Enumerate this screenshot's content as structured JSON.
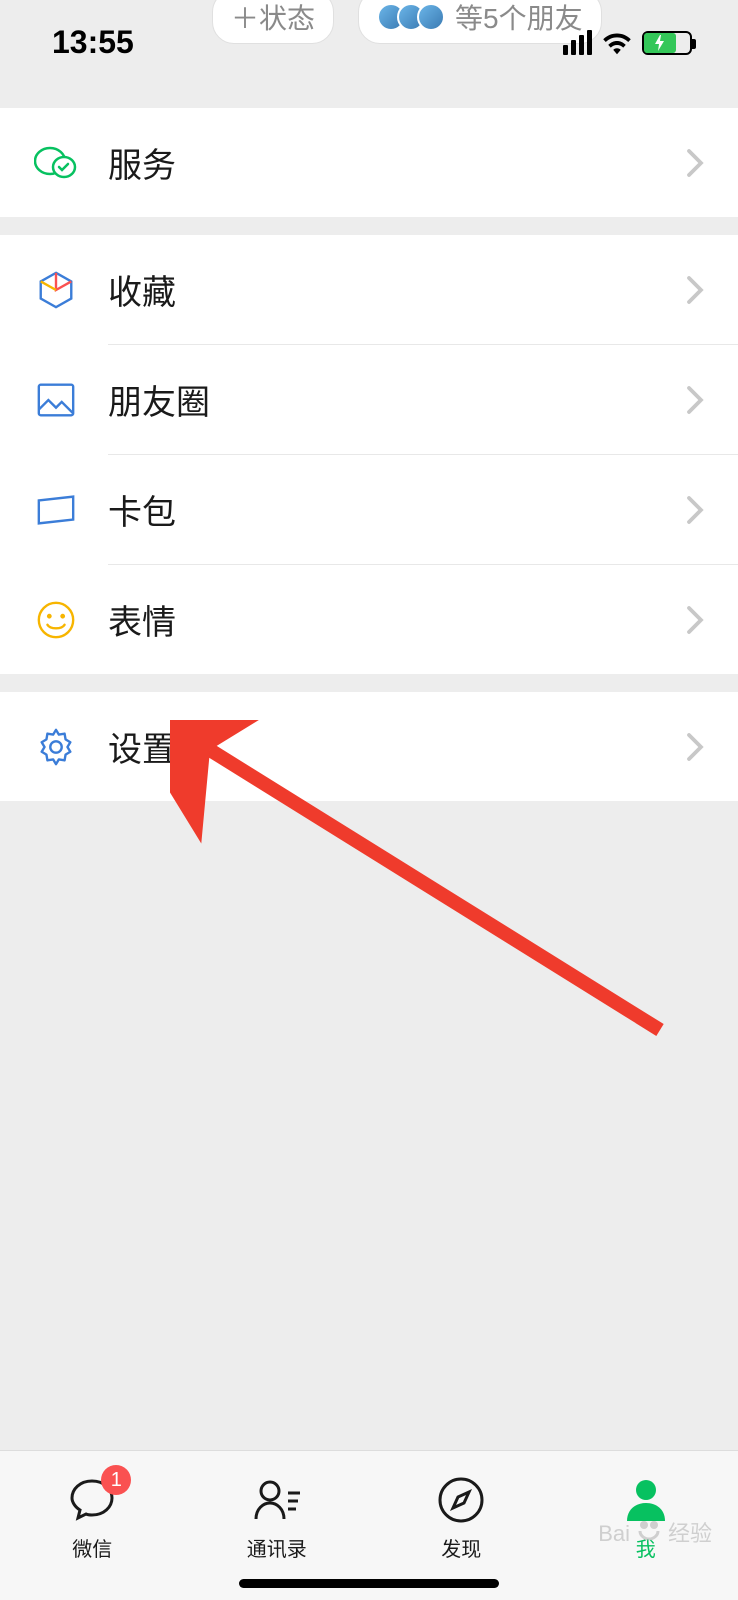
{
  "status_bar": {
    "time": "13:55"
  },
  "header": {
    "status_pill": "＋状态",
    "friends_pill": "等5个朋友"
  },
  "menu": {
    "services": "服务",
    "favorites": "收藏",
    "moments": "朋友圈",
    "cards": "卡包",
    "stickers": "表情",
    "settings": "设置"
  },
  "tabs": {
    "chats": {
      "label": "微信",
      "badge": "1"
    },
    "contacts": {
      "label": "通讯录"
    },
    "discover": {
      "label": "发现"
    },
    "me": {
      "label": "我"
    }
  },
  "watermark": {
    "brand": "Bai",
    "brand2": "经验"
  }
}
